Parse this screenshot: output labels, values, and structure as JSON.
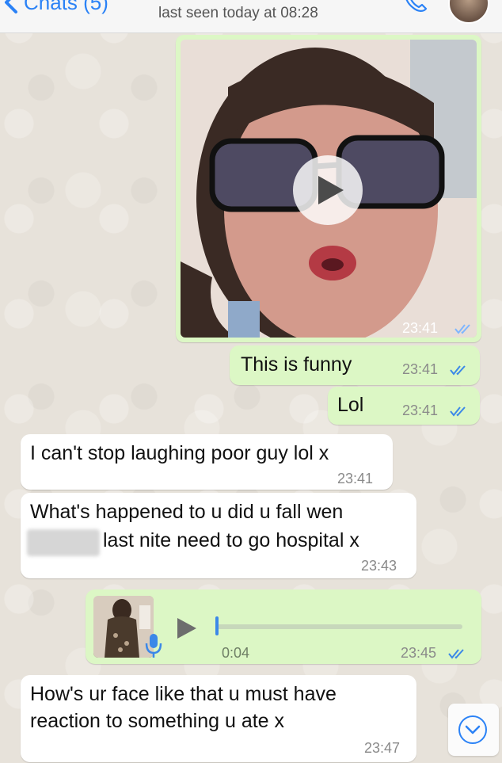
{
  "header": {
    "back_label": "Chats (5)",
    "last_seen": "last seen today at 08:28"
  },
  "messages": {
    "video": {
      "time": "23:41"
    },
    "m1": {
      "text": "This is funny",
      "time": "23:41"
    },
    "m2": {
      "text": "Lol",
      "time": "23:41"
    },
    "m3": {
      "text": "I can't stop laughing poor guy lol x",
      "time": "23:41"
    },
    "m4": {
      "line1": "What's happened to u did u fall wen",
      "line2": "last nite need to go hospital x",
      "time": "23:43"
    },
    "voice": {
      "duration": "0:04",
      "time": "23:45"
    },
    "m5": {
      "line1": "How's ur face like that u must have",
      "line2": "reaction to something u ate x",
      "time": "23:47"
    }
  },
  "colors": {
    "outgoing_bubble": "#dcf7c5",
    "incoming_bubble": "#ffffff",
    "read_ticks": "#3b88e8",
    "accent": "#2b82f6"
  },
  "icons": [
    "chevron-left-icon",
    "phone-icon",
    "play-icon",
    "read-ticks-icon",
    "mic-icon",
    "chevron-down-icon"
  ]
}
